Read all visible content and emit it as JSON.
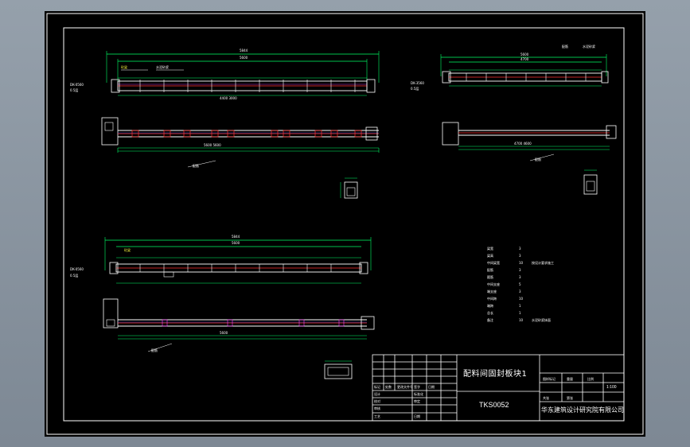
{
  "colors": {
    "background": "#8f9aa6",
    "sheet": "#000000",
    "frame": "#ffffff",
    "dimension": "#00ff66",
    "outline": "#ffffff",
    "red_line": "#ff3030",
    "magenta": "#ff40ff",
    "blue": "#4060ff",
    "yellow": "#ffff40",
    "cyan": "#00e0ff"
  },
  "title_block": {
    "drawing_title": "配料间固封板块1",
    "drawing_number": "TKS0052",
    "org_name": "华东建筑设计研究院有限公司",
    "scale": "1:100"
  }
}
